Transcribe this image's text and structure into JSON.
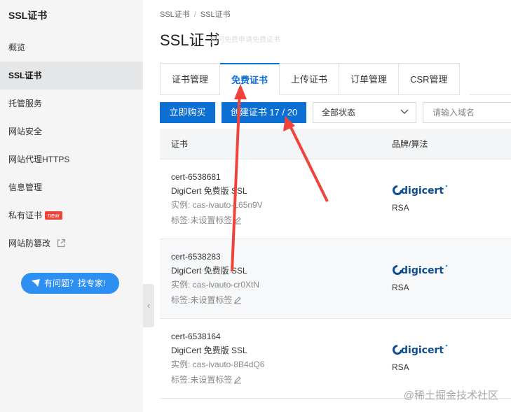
{
  "sidebar": {
    "title": "SSL证书",
    "items": [
      {
        "label": "概览"
      },
      {
        "label": "SSL证书"
      },
      {
        "label": "托管服务"
      },
      {
        "label": "网站安全"
      },
      {
        "label": "网站代理HTTPS"
      },
      {
        "label": "信息管理"
      },
      {
        "label": "私有证书",
        "badge": "new"
      },
      {
        "label": "网站防篡改"
      }
    ],
    "help_label": "有问题？找专家!"
  },
  "breadcrumb": [
    "SSL证书",
    "/",
    "SSL证书"
  ],
  "page": {
    "title": "SSL证书",
    "ghost_tip": "如何免费申请免费证书"
  },
  "tabs": [
    {
      "label": "证书管理"
    },
    {
      "label": "免费证书"
    },
    {
      "label": "上传证书"
    },
    {
      "label": "订单管理"
    },
    {
      "label": "CSR管理"
    }
  ],
  "toolbar": {
    "buy_label": "立即购买",
    "create_label": "创建证书 17 / 20",
    "status_value": "全部状态",
    "search_placeholder": "请输入域名"
  },
  "table": {
    "headers": [
      "证书",
      "品牌/算法"
    ],
    "rows": [
      {
        "id": "cert-6538681",
        "product": "DigiCert 免费版 SSL",
        "instance": "实例: cas-ivauto-L65n9V",
        "tag": "标签:未设置标签",
        "brand": "digicert",
        "algorithm": "RSA"
      },
      {
        "id": "cert-6538283",
        "product": "DigiCert 免费版 SSL",
        "instance": "实例: cas-ivauto-cr0XtN",
        "tag": "标签:未设置标签",
        "brand": "digicert",
        "algorithm": "RSA"
      },
      {
        "id": "cert-6538164",
        "product": "DigiCert 免费版 SSL",
        "instance": "实例: cas-ivauto-8B4dQ6",
        "tag": "标签:未设置标签",
        "brand": "digicert",
        "algorithm": "RSA"
      }
    ]
  },
  "watermark": "@稀土掘金技术社区",
  "colors": {
    "accent": "#0b6fd3",
    "arrow": "#f0443a",
    "help_button": "#2e8ff2",
    "sidebar_bg": "#f5f5f5"
  }
}
